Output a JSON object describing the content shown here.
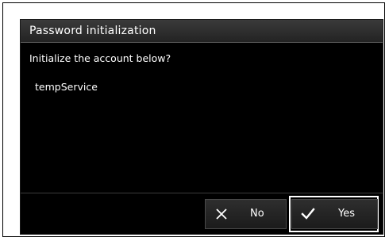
{
  "dialog": {
    "title": "Password initialization",
    "message": "Initialize the account below?",
    "account": "tempService"
  },
  "buttons": {
    "no_label": "No",
    "yes_label": "Yes",
    "no_icon": "close-icon",
    "yes_icon": "checkmark-icon",
    "selected": "Yes"
  },
  "colors": {
    "dialog_background": "#000000",
    "title_bar": "#2c2c2c",
    "text": "#ffffff",
    "focus_outline": "#ffffff"
  }
}
